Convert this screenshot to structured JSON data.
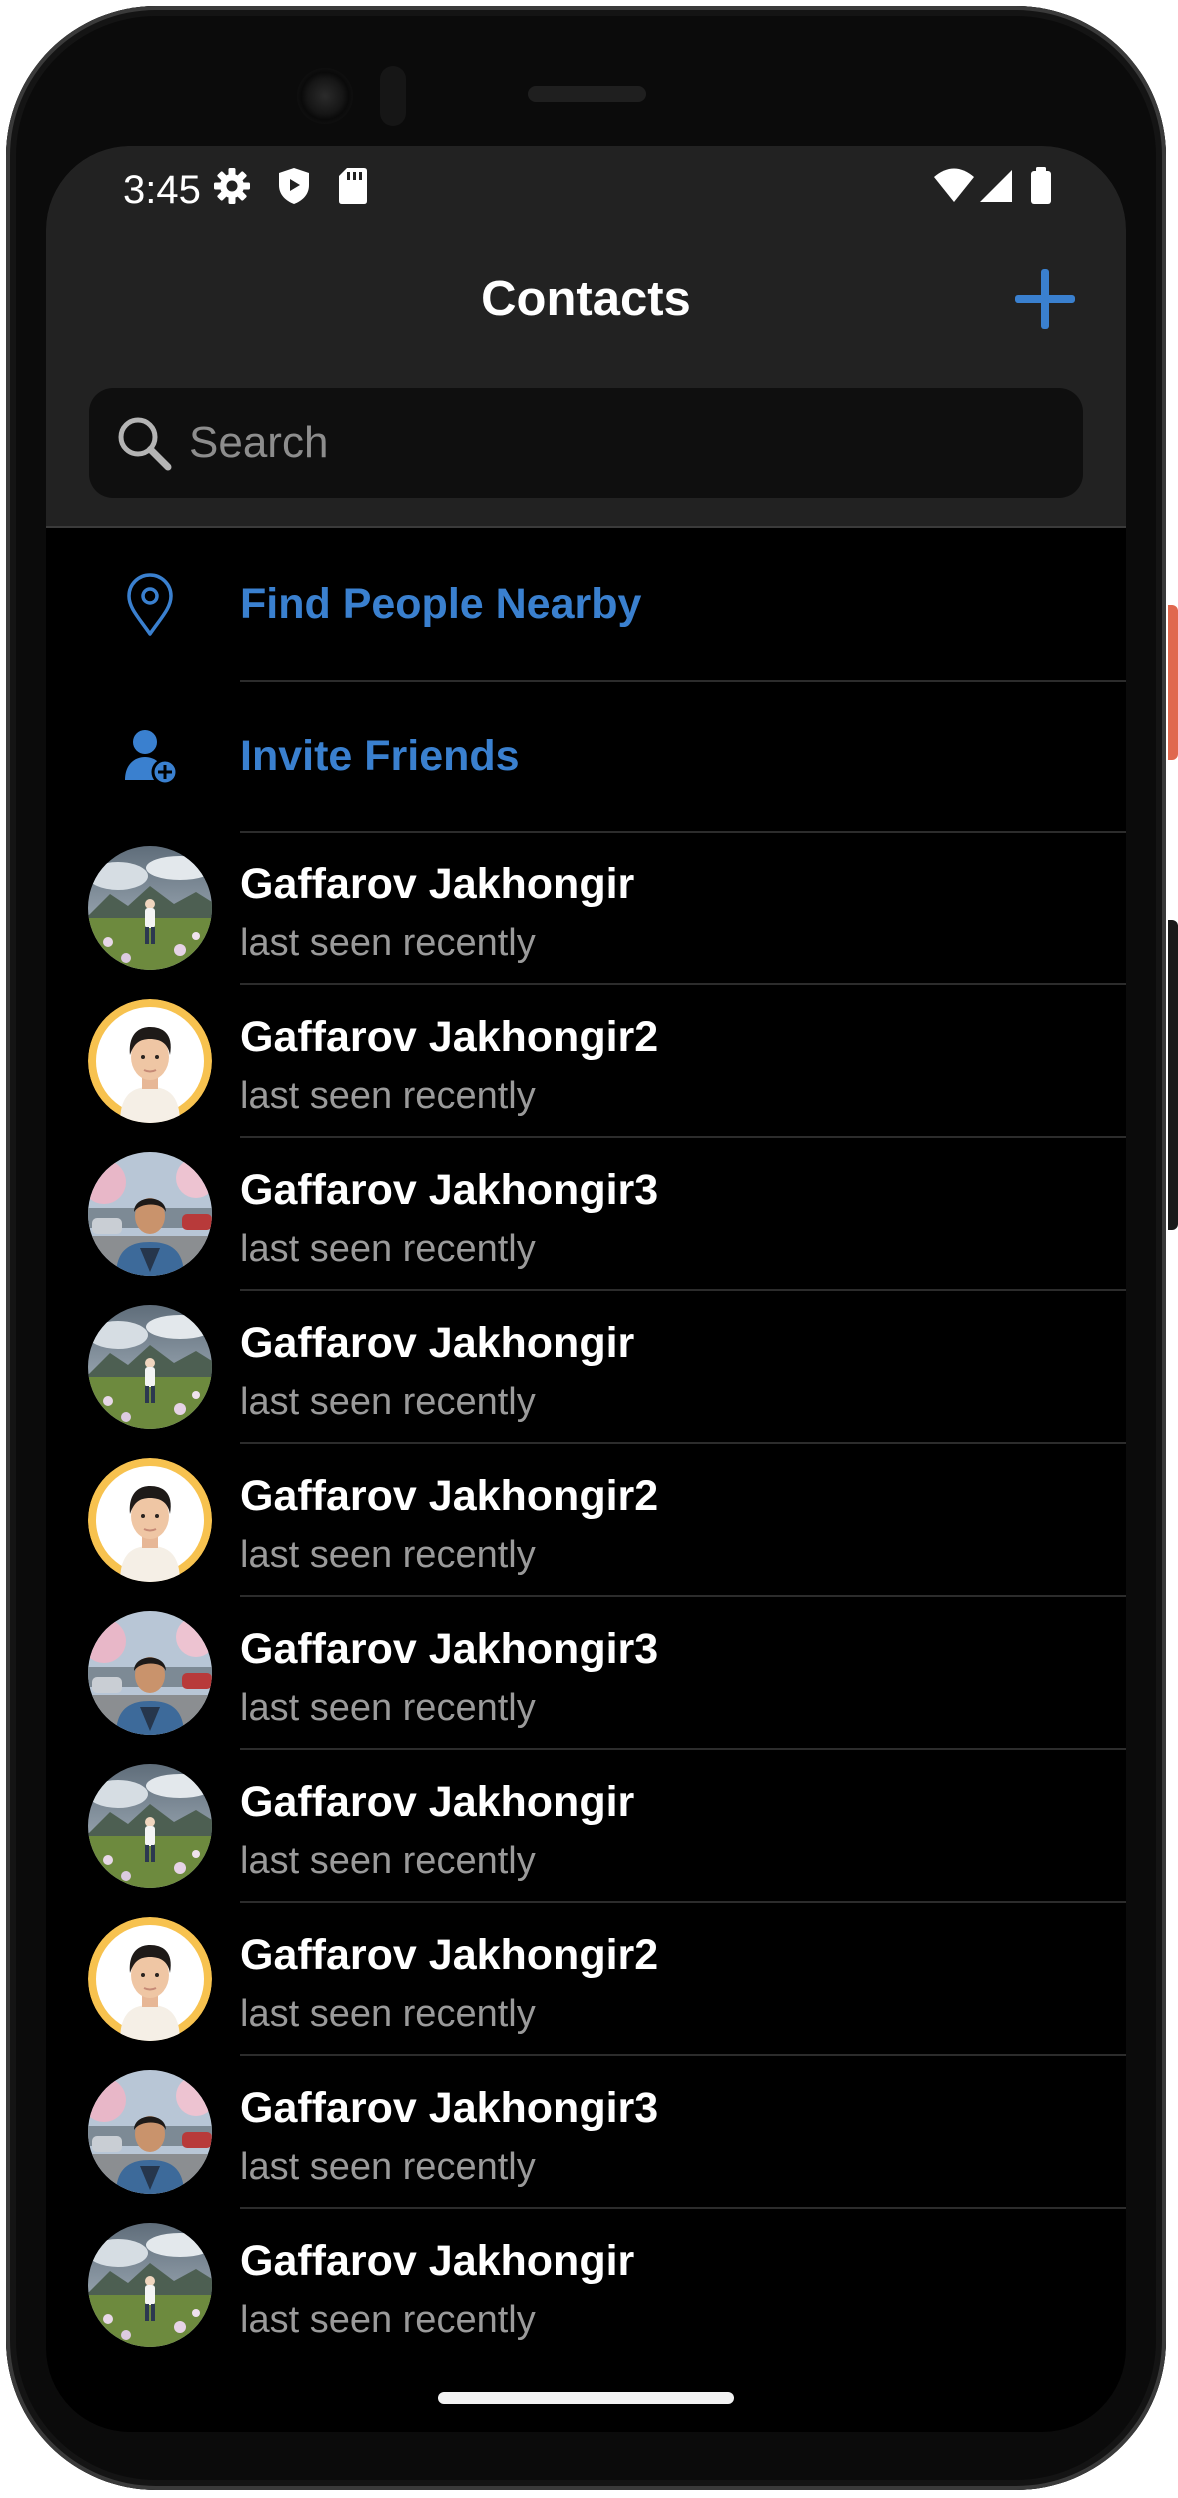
{
  "status_bar": {
    "time": "3:45",
    "left_icons": [
      "gear-icon",
      "shield-icon",
      "sd-card-icon"
    ],
    "right_icons": [
      "wifi-icon",
      "signal-icon",
      "battery-icon"
    ]
  },
  "header": {
    "title": "Contacts",
    "add_icon": "plus-icon"
  },
  "search": {
    "placeholder": "Search",
    "value": ""
  },
  "actions": [
    {
      "label": "Find People Nearby",
      "icon": "location-pin-icon"
    },
    {
      "label": "Invite Friends",
      "icon": "add-person-icon"
    }
  ],
  "contacts": [
    {
      "name": "Gaffarov Jakhongir",
      "status": "last seen recently",
      "avatar": "landscape-photo"
    },
    {
      "name": "Gaffarov Jakhongir2",
      "status": "last seen recently",
      "avatar": "portrait-photo"
    },
    {
      "name": "Gaffarov Jakhongir3",
      "status": "last seen recently",
      "avatar": "street-photo"
    },
    {
      "name": "Gaffarov Jakhongir",
      "status": "last seen recently",
      "avatar": "landscape-photo"
    },
    {
      "name": "Gaffarov Jakhongir2",
      "status": "last seen recently",
      "avatar": "portrait-photo"
    },
    {
      "name": "Gaffarov Jakhongir3",
      "status": "last seen recently",
      "avatar": "street-photo"
    },
    {
      "name": "Gaffarov Jakhongir",
      "status": "last seen recently",
      "avatar": "landscape-photo"
    },
    {
      "name": "Gaffarov Jakhongir2",
      "status": "last seen recently",
      "avatar": "portrait-photo"
    },
    {
      "name": "Gaffarov Jakhongir3",
      "status": "last seen recently",
      "avatar": "street-photo"
    },
    {
      "name": "Gaffarov Jakhongir",
      "status": "last seen recently",
      "avatar": "landscape-photo"
    }
  ],
  "colors": {
    "accent": "#3a80cf",
    "header_background": "#222222",
    "list_background": "#000000",
    "secondary_text": "#9a9a9a",
    "portrait_ring": "#f7c24f"
  }
}
